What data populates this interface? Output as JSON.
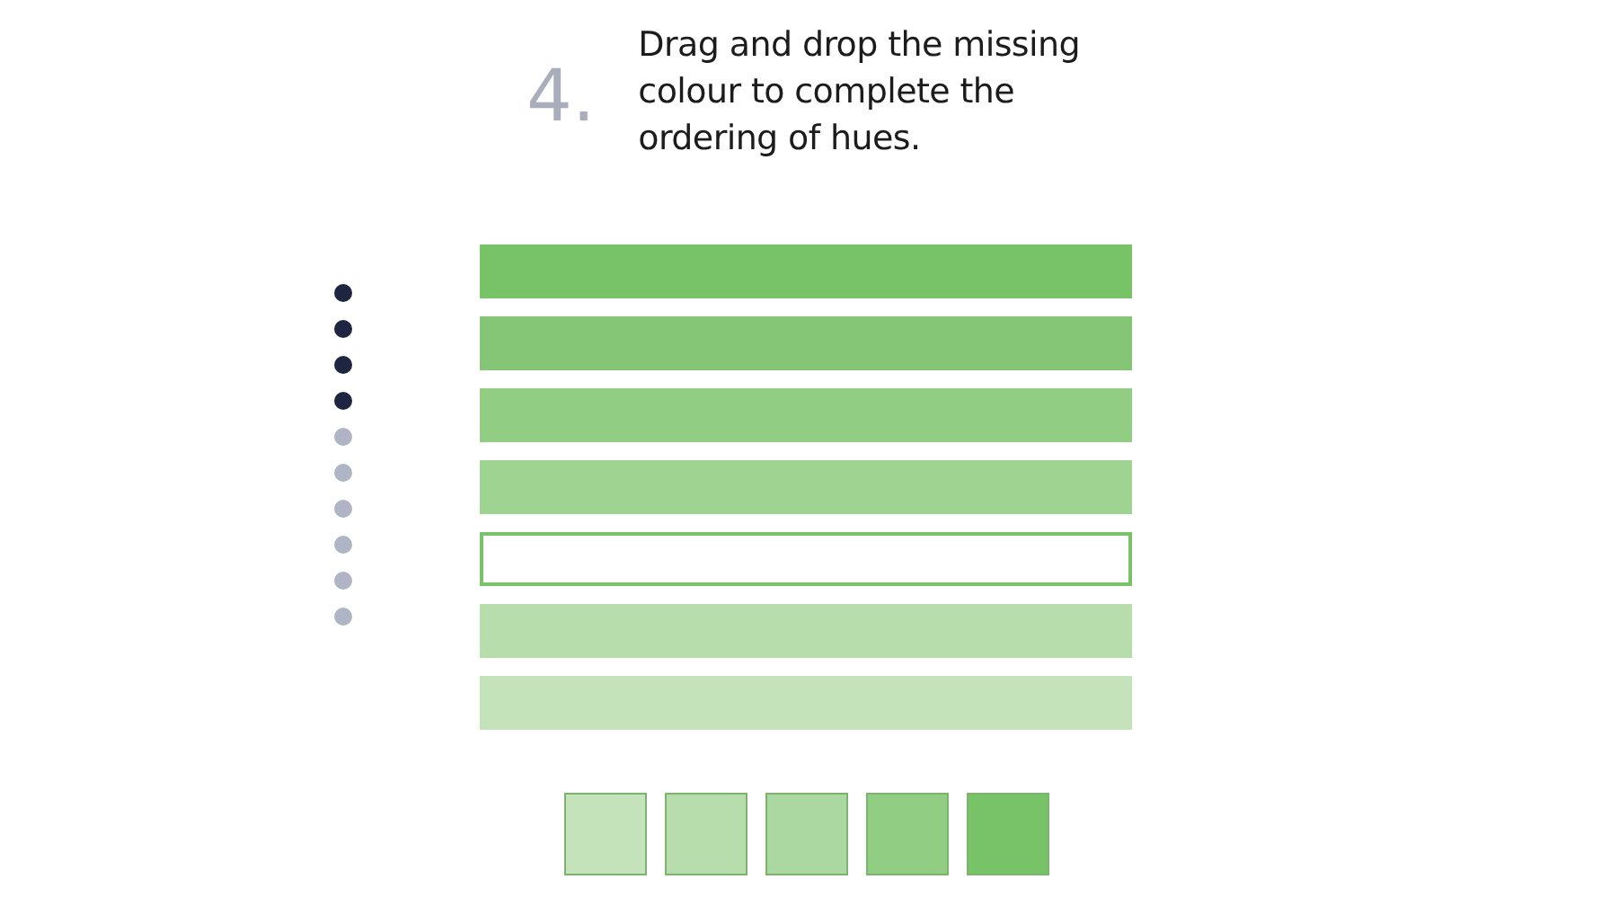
{
  "question": {
    "number": "4.",
    "text": "Drag and drop the missing colour to complete the ordering of hues."
  },
  "progress": [
    {
      "done": true
    },
    {
      "done": true
    },
    {
      "done": true
    },
    {
      "done": true
    },
    {
      "done": false
    },
    {
      "done": false
    },
    {
      "done": false
    },
    {
      "done": false
    },
    {
      "done": false
    },
    {
      "done": false
    }
  ],
  "bars": [
    {
      "kind": "filled",
      "color": "#78c267"
    },
    {
      "kind": "filled",
      "color": "#84c675"
    },
    {
      "kind": "filled",
      "color": "#91cd83"
    },
    {
      "kind": "filled",
      "color": "#9fd391"
    },
    {
      "kind": "empty",
      "color": "#78c267"
    },
    {
      "kind": "filled",
      "color": "#b7ddad"
    },
    {
      "kind": "filled",
      "color": "#c4e3bb"
    }
  ],
  "swatches": [
    {
      "color": "#c4e3bb"
    },
    {
      "color": "#b7ddad"
    },
    {
      "color": "#aad8a0"
    },
    {
      "color": "#91cd83"
    },
    {
      "color": "#78c267"
    }
  ]
}
